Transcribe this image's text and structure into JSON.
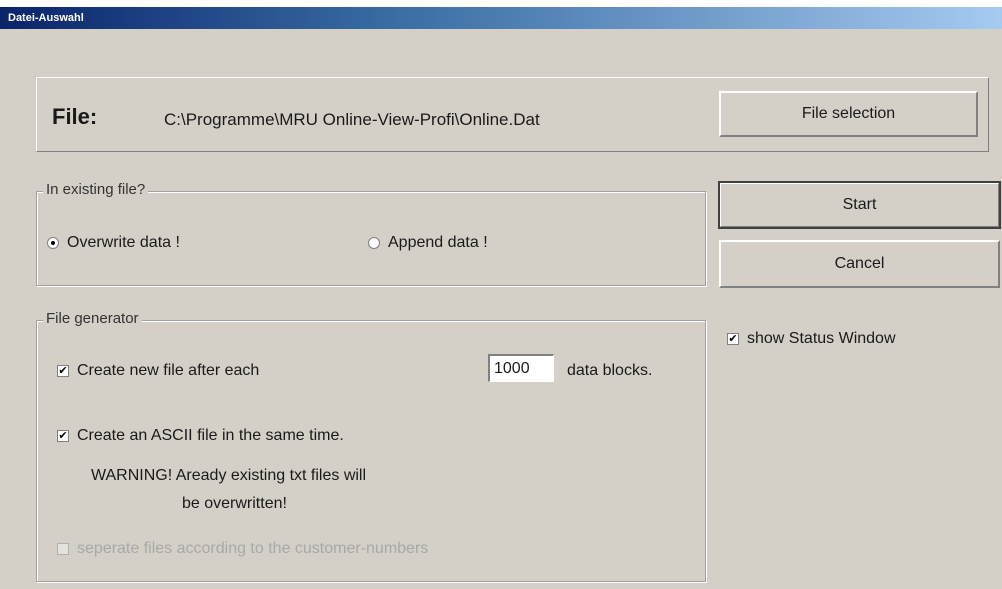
{
  "window": {
    "title": "Datei-Auswahl"
  },
  "file": {
    "label": "File:",
    "path": "C:\\Programme\\MRU Online-View-Profi\\Online.Dat",
    "select_button": "File selection"
  },
  "existing_file": {
    "legend": "In existing file?",
    "overwrite_label": "Overwrite data !",
    "overwrite_selected": true,
    "append_label": "Append data !",
    "append_selected": false
  },
  "actions": {
    "start_label": "Start",
    "cancel_label": "Cancel",
    "show_status_label": "show Status Window",
    "show_status_checked": true
  },
  "generator": {
    "legend": "File generator",
    "new_file_label": "Create new file after each",
    "new_file_checked": true,
    "blocks_value": "1000",
    "blocks_unit": "data blocks.",
    "ascii_label": "Create an ASCII file in the same time.",
    "ascii_checked": true,
    "warning_line1": "WARNING! Aready existing txt files will",
    "warning_line2": "be overwritten!",
    "separate_label": "seperate files according to the customer-numbers",
    "separate_checked": false,
    "separate_enabled": false
  }
}
